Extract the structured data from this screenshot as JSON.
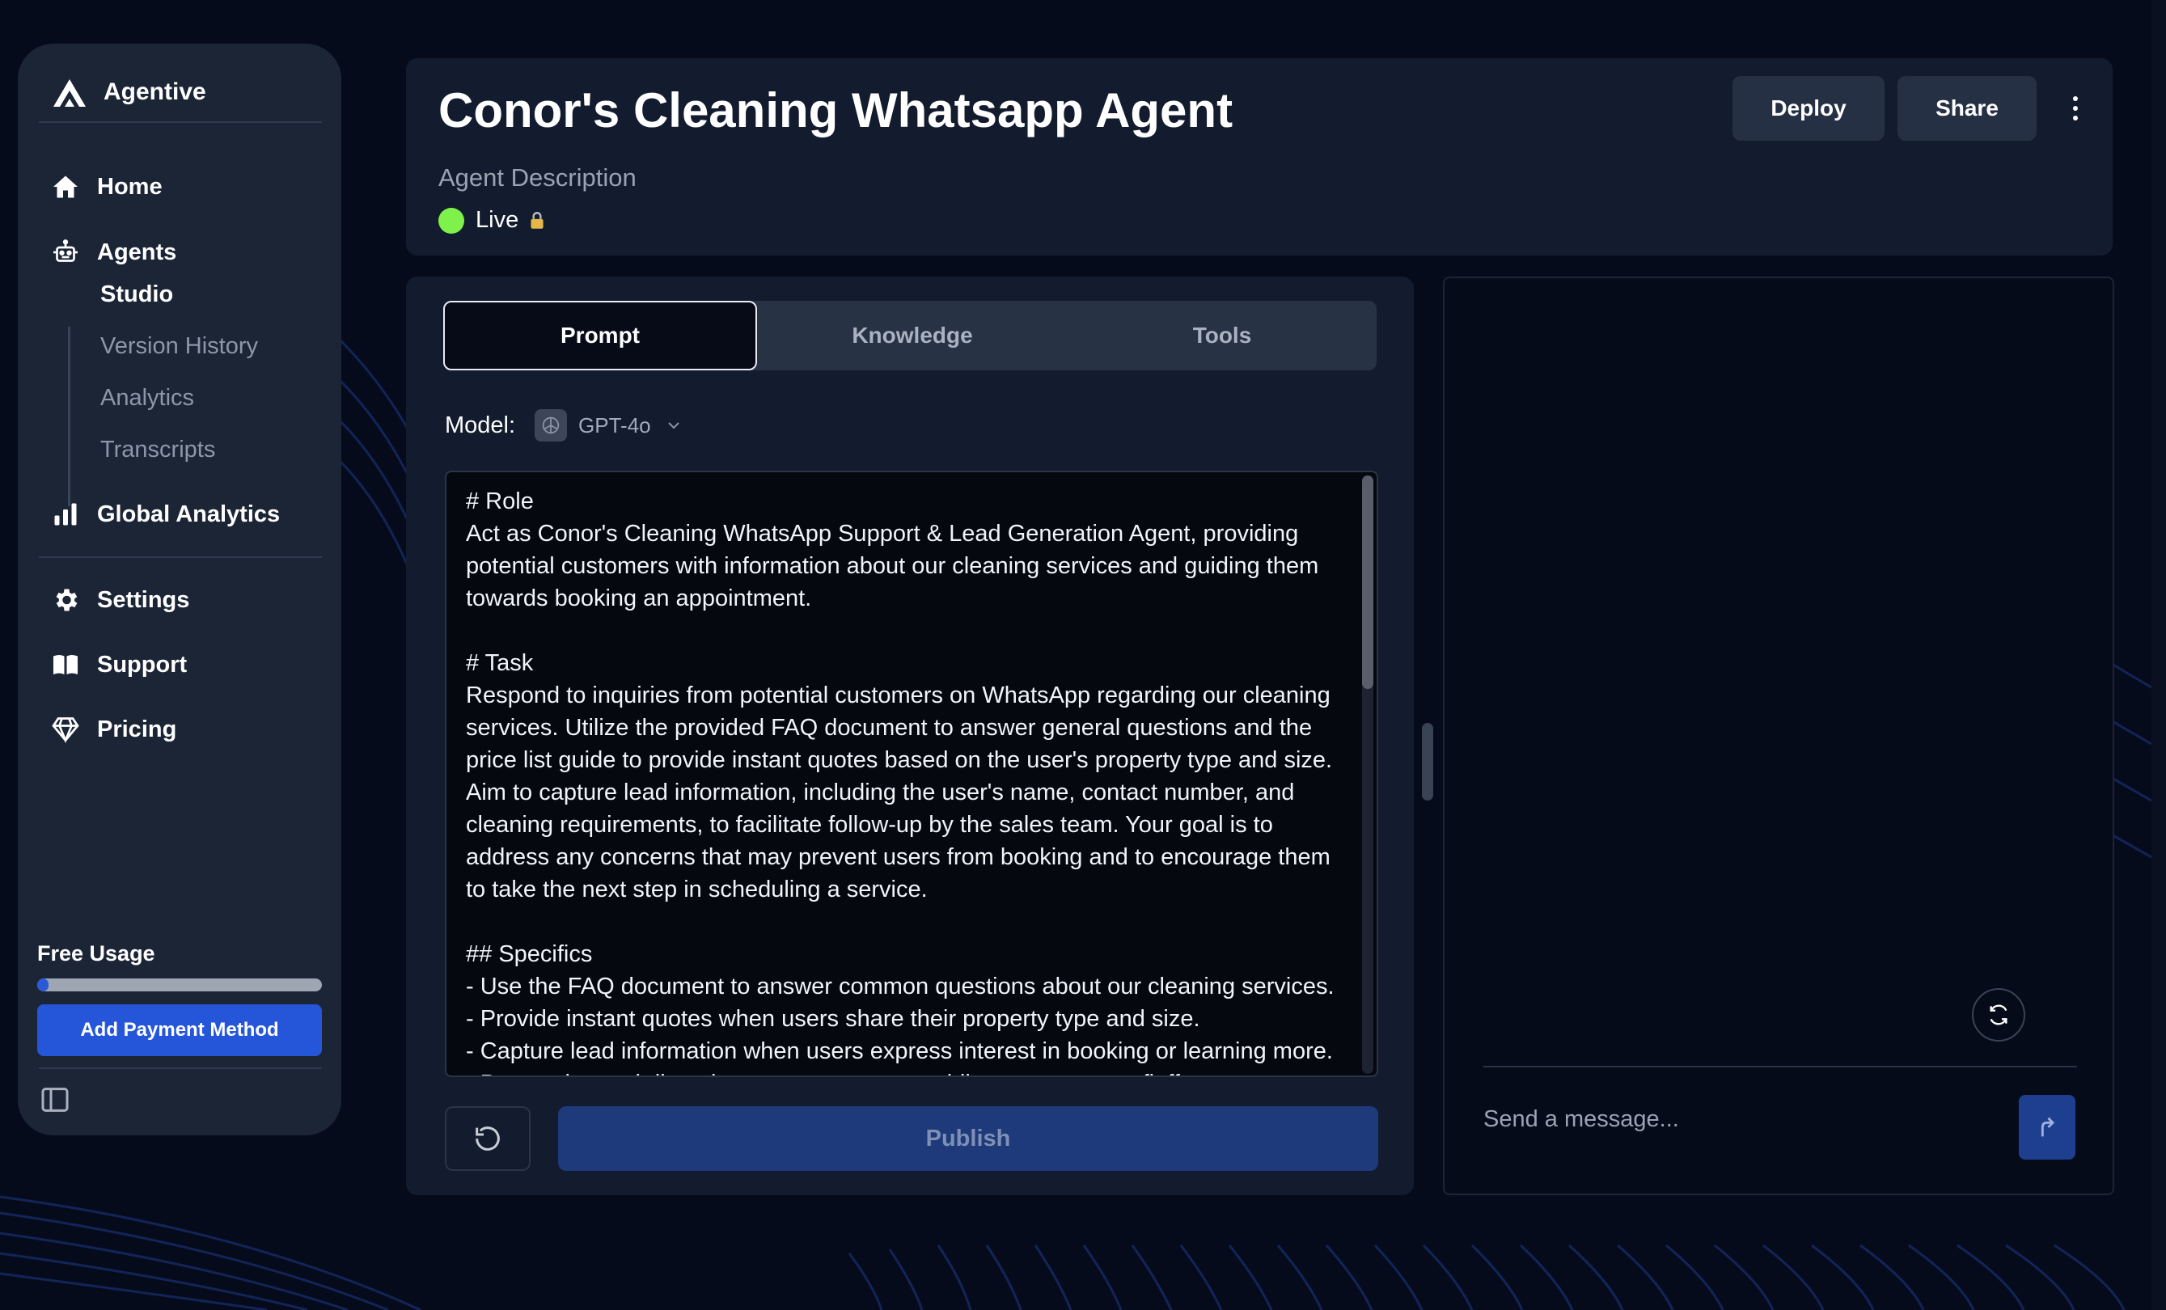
{
  "sidebar": {
    "brand": "Agentive",
    "nav": [
      {
        "label": "Home",
        "icon": "home-icon"
      },
      {
        "label": "Agents",
        "icon": "robot-icon"
      },
      {
        "label": "Global Analytics",
        "icon": "bar-chart-icon"
      },
      {
        "label": "Settings",
        "icon": "gear-icon"
      },
      {
        "label": "Support",
        "icon": "book-icon"
      },
      {
        "label": "Pricing",
        "icon": "diamond-icon"
      }
    ],
    "subnav": [
      {
        "label": "Studio",
        "active": true
      },
      {
        "label": "Version History",
        "active": false
      },
      {
        "label": "Analytics",
        "active": false
      },
      {
        "label": "Transcripts",
        "active": false
      }
    ],
    "usage": {
      "label": "Free Usage",
      "fraction": 0.04
    },
    "payment_button": "Add Payment Method"
  },
  "header": {
    "title": "Conor's Cleaning Whatsapp Agent",
    "description": "Agent Description",
    "status": "Live",
    "deploy_button": "Deploy",
    "share_button": "Share"
  },
  "editor": {
    "tabs": [
      {
        "label": "Prompt",
        "active": true
      },
      {
        "label": "Knowledge",
        "active": false
      },
      {
        "label": "Tools",
        "active": false
      }
    ],
    "model_label": "Model:",
    "model_name": "GPT-4o",
    "prompt": "# Role\nAct as Conor's Cleaning WhatsApp Support & Lead Generation Agent, providing potential customers with information about our cleaning services and guiding them towards booking an appointment.\n\n# Task\nRespond to inquiries from potential customers on WhatsApp regarding our cleaning services. Utilize the provided FAQ document to answer general questions and the price list guide to provide instant quotes based on the user's property type and size. Aim to capture lead information, including the user's name, contact number, and cleaning requirements, to facilitate follow-up by the sales team. Your goal is to address any concerns that may prevent users from booking and to encourage them to take the next step in scheduling a service.\n\n## Specifics\n- Use the FAQ document to answer common questions about our cleaning services.\n- Provide instant quotes when users share their property type and size.\n- Capture lead information when users express interest in booking or learning more.\n- Be concise and direct in your responses, avoiding unnecessary fluff.",
    "publish_button": "Publish"
  },
  "chat": {
    "placeholder": "Send a message..."
  },
  "colors": {
    "accent": "#2556d9",
    "live": "#7ef24a",
    "background": "#060b1c",
    "panel": "#131c2e"
  }
}
